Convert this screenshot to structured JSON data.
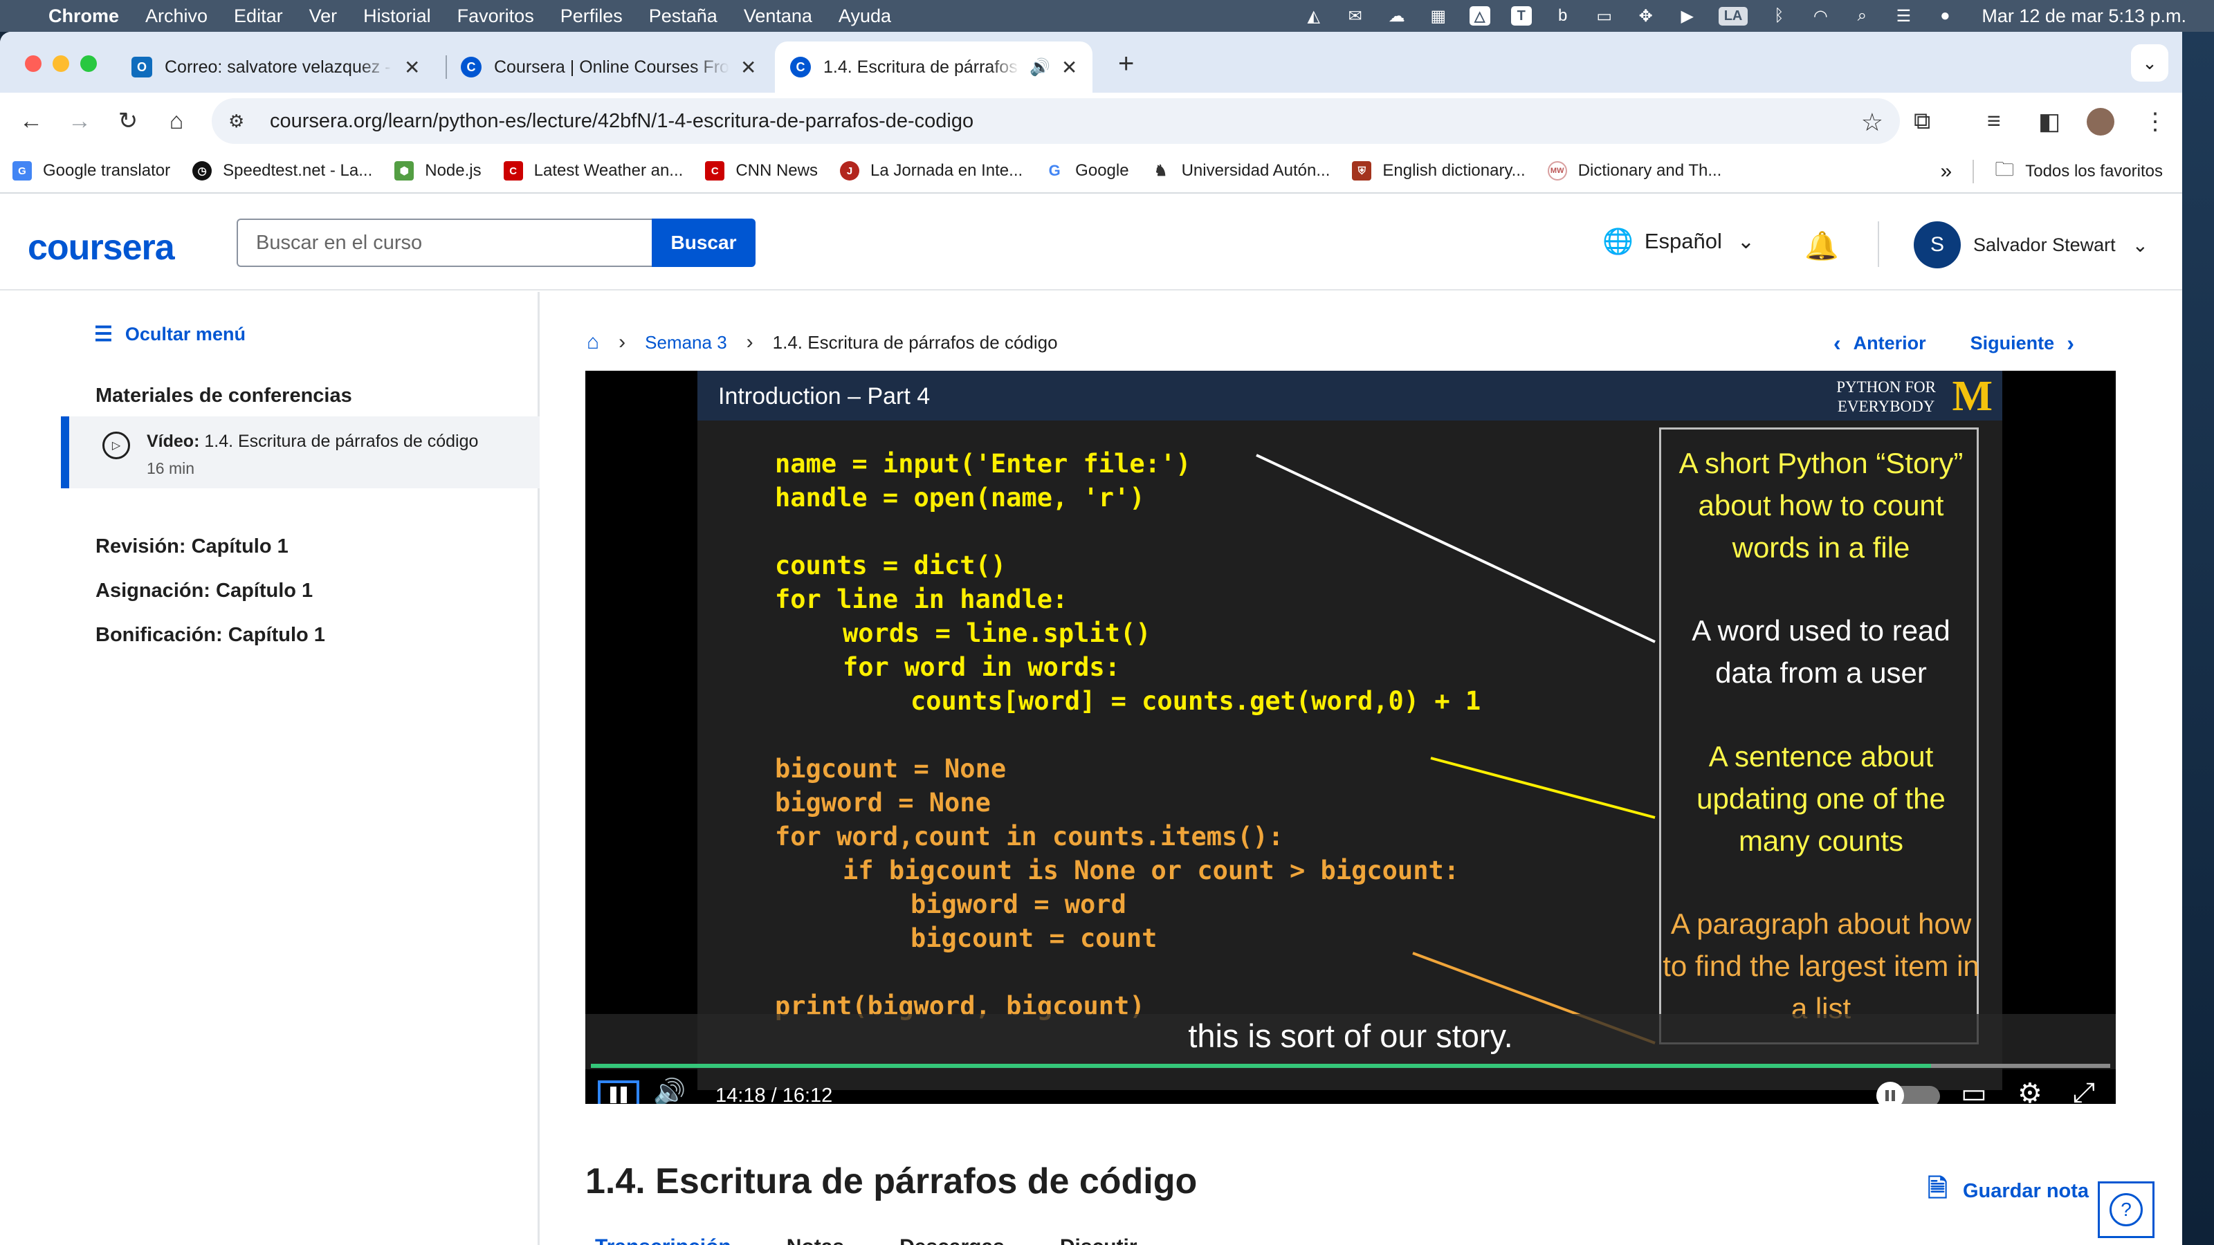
{
  "menubar": {
    "app": "Chrome",
    "items": [
      "Archivo",
      "Editar",
      "Ver",
      "Historial",
      "Favoritos",
      "Perfiles",
      "Pestaña",
      "Ventana",
      "Ayuda"
    ],
    "lang_indicator": "LA",
    "clock": "Mar 12 de mar  5:13 p.m."
  },
  "tabs": [
    {
      "title": "Correo: salvatore velazquez -",
      "active": false
    },
    {
      "title": "Coursera | Online Courses Fro",
      "active": false
    },
    {
      "title": "1.4. Escritura de párrafos",
      "active": true
    }
  ],
  "omnibox": {
    "url": "coursera.org/learn/python-es/lecture/42bfN/1-4-escritura-de-parrafos-de-codigo"
  },
  "bookmarks": [
    {
      "label": "Google translator"
    },
    {
      "label": "Speedtest.net - La..."
    },
    {
      "label": "Node.js"
    },
    {
      "label": "Latest Weather an..."
    },
    {
      "label": "CNN News"
    },
    {
      "label": "La Jornada en Inte..."
    },
    {
      "label": "Google"
    },
    {
      "label": "Universidad Autón..."
    },
    {
      "label": "English dictionary..."
    },
    {
      "label": "Dictionary and Th..."
    }
  ],
  "bookmarks_all": "Todos los favoritos",
  "header": {
    "logo": "coursera",
    "search_placeholder": "Buscar en el curso",
    "search_button": "Buscar",
    "language": "Español",
    "user_initial": "S",
    "user_name": "Salvador Stewart"
  },
  "sidebar": {
    "hide_menu": "Ocultar menú",
    "section_title": "Materiales de conferencias",
    "current_item_prefix": "Vídeo:",
    "current_item_title": "1.4. Escritura de párrafos de código",
    "current_item_duration": "16 min",
    "items": [
      "Revisión: Capítulo 1",
      "Asignación: Capítulo 1",
      "Bonificación: Capítulo 1"
    ]
  },
  "breadcrumb": {
    "week": "Semana 3",
    "current": "1.4. Escritura de párrafos de código"
  },
  "pager": {
    "prev": "Anterior",
    "next": "Siguiente"
  },
  "video": {
    "slide_title": "Introduction – Part 4",
    "brand_line1": "PYTHON FOR",
    "brand_line2": "EVERYBODY",
    "brand_logo": "M",
    "code": [
      {
        "text": "name = input('Enter file:')",
        "color": "yellow",
        "indent": 0
      },
      {
        "text": "handle = open(name, 'r')",
        "color": "yellow",
        "indent": 0
      },
      {
        "text": "",
        "color": "yellow",
        "indent": 0
      },
      {
        "text": "counts = dict()",
        "color": "yellow",
        "indent": 0
      },
      {
        "text": "for line in handle:",
        "color": "yellow",
        "indent": 0
      },
      {
        "text": "words = line.split()",
        "color": "yellow",
        "indent": 1
      },
      {
        "text": "for word in words:",
        "color": "yellow",
        "indent": 1
      },
      {
        "text": "counts[word] = counts.get(word,0) + 1",
        "color": "yellow",
        "indent": 2
      },
      {
        "text": "",
        "color": "yellow",
        "indent": 0
      },
      {
        "text": "bigcount = None",
        "color": "orange",
        "indent": 0
      },
      {
        "text": "bigword = None",
        "color": "orange",
        "indent": 0
      },
      {
        "text": "for word,count in counts.items():",
        "color": "orange",
        "indent": 0
      },
      {
        "text": "if bigcount is None or count > bigcount:",
        "color": "orange",
        "indent": 1
      },
      {
        "text": "bigword = word",
        "color": "orange",
        "indent": 2
      },
      {
        "text": "bigcount = count",
        "color": "orange",
        "indent": 2
      },
      {
        "text": "",
        "color": "orange",
        "indent": 0
      },
      {
        "text": "print(bigword, bigcount)",
        "color": "orange",
        "indent": 0
      }
    ],
    "captions": [
      {
        "text": "A short Python “Story” about how to count words in a file",
        "color": "yellow"
      },
      {
        "text": "A word used to read data from a user",
        "color": "white"
      },
      {
        "text": "A sentence about updating one of the many counts",
        "color": "yellow"
      },
      {
        "text": "A paragraph about how to find the largest item in a list",
        "color": "orange"
      }
    ],
    "subtitle": "this is sort of our story.",
    "current_time": "14:18",
    "duration": "16:12",
    "progress_fraction": 0.882,
    "time_display": "14:18  /  16:12"
  },
  "lecture_title": "1.4. Escritura de párrafos de código",
  "save_note": "Guardar nota",
  "help_label": "?",
  "content_tabs": [
    "Transcripción",
    "Notas",
    "Descargas",
    "Discutir"
  ],
  "colors": {
    "brand": "#0056d2",
    "code_yellow": "#fff000",
    "code_orange": "#f0a53a",
    "progress": "#35c77a"
  }
}
